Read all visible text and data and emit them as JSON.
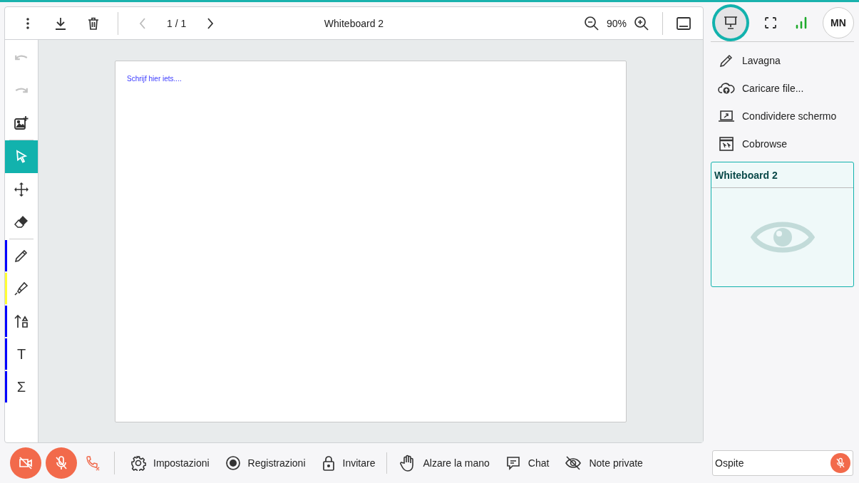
{
  "toolbar": {
    "title": "Whiteboard 2",
    "page_indicator": "1 / 1",
    "previous_disabled": true,
    "zoom": "90%"
  },
  "tool_groups": [
    [
      {
        "kind": "undo",
        "disabled": true,
        "selected": false
      },
      {
        "kind": "redo",
        "disabled": true,
        "selected": false
      },
      {
        "kind": "add-image",
        "disabled": false,
        "selected": false
      }
    ],
    [
      {
        "kind": "select",
        "disabled": false,
        "selected": true
      },
      {
        "kind": "move",
        "disabled": false,
        "selected": false
      },
      {
        "kind": "eraser",
        "disabled": false,
        "selected": false
      }
    ],
    [
      {
        "kind": "pen",
        "disabled": false,
        "selected": false,
        "color": "#0000ff"
      },
      {
        "kind": "highlighter",
        "disabled": false,
        "selected": false,
        "color": "#ffff33"
      },
      {
        "kind": "shapes",
        "disabled": false,
        "selected": false,
        "color": "#0000ff"
      },
      {
        "kind": "text",
        "disabled": false,
        "selected": false,
        "color": "#0000ff",
        "glyph": "T"
      },
      {
        "kind": "formula",
        "disabled": false,
        "selected": false,
        "color": "#0000ff",
        "glyph": "Σ"
      }
    ]
  ],
  "canvas": {
    "text": "Schrijf hier iets...."
  },
  "sidebar": {
    "present_selected": true,
    "avatar": "MN",
    "menu": [
      {
        "kind": "pencil",
        "label": "Lavagna"
      },
      {
        "kind": "upload",
        "label": "Caricare file..."
      },
      {
        "kind": "screen",
        "label": "Condividere schermo"
      },
      {
        "kind": "cobrowse",
        "label": "Cobrowse"
      }
    ],
    "card": {
      "title": "Whiteboard 2"
    }
  },
  "bottom_bar": {
    "camera_off": true,
    "mic_muted": true,
    "actions": [
      {
        "kind": "settings",
        "label": "Impostazioni"
      },
      {
        "kind": "record",
        "label": "Registrazioni"
      },
      {
        "kind": "lock",
        "label": "Invitare"
      },
      {
        "kind": "hand",
        "label": "Alzare la mano"
      },
      {
        "kind": "chat",
        "label": "Chat"
      },
      {
        "kind": "eye-off",
        "label": "Note private"
      }
    ],
    "guest": {
      "value": "Ospite",
      "muted": true
    }
  }
}
